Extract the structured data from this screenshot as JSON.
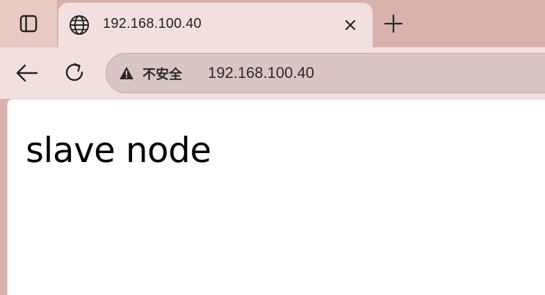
{
  "tab": {
    "title": "192.168.100.40"
  },
  "omnibox": {
    "security_label": "不安全",
    "url": "192.168.100.40"
  },
  "page": {
    "heading": "slave node"
  },
  "colors": {
    "frame": "#d9b3ab",
    "tab_active": "#f2e0de",
    "omnibox_bg": "#d9c6c4",
    "content_bg": "#ffffff"
  },
  "icons": {
    "sidebar": "sidebar-toggle-icon",
    "site": "globe-icon",
    "close": "close-icon",
    "new_tab": "plus-icon",
    "back": "back-arrow-icon",
    "reload": "reload-icon",
    "security": "warning-triangle-icon"
  }
}
